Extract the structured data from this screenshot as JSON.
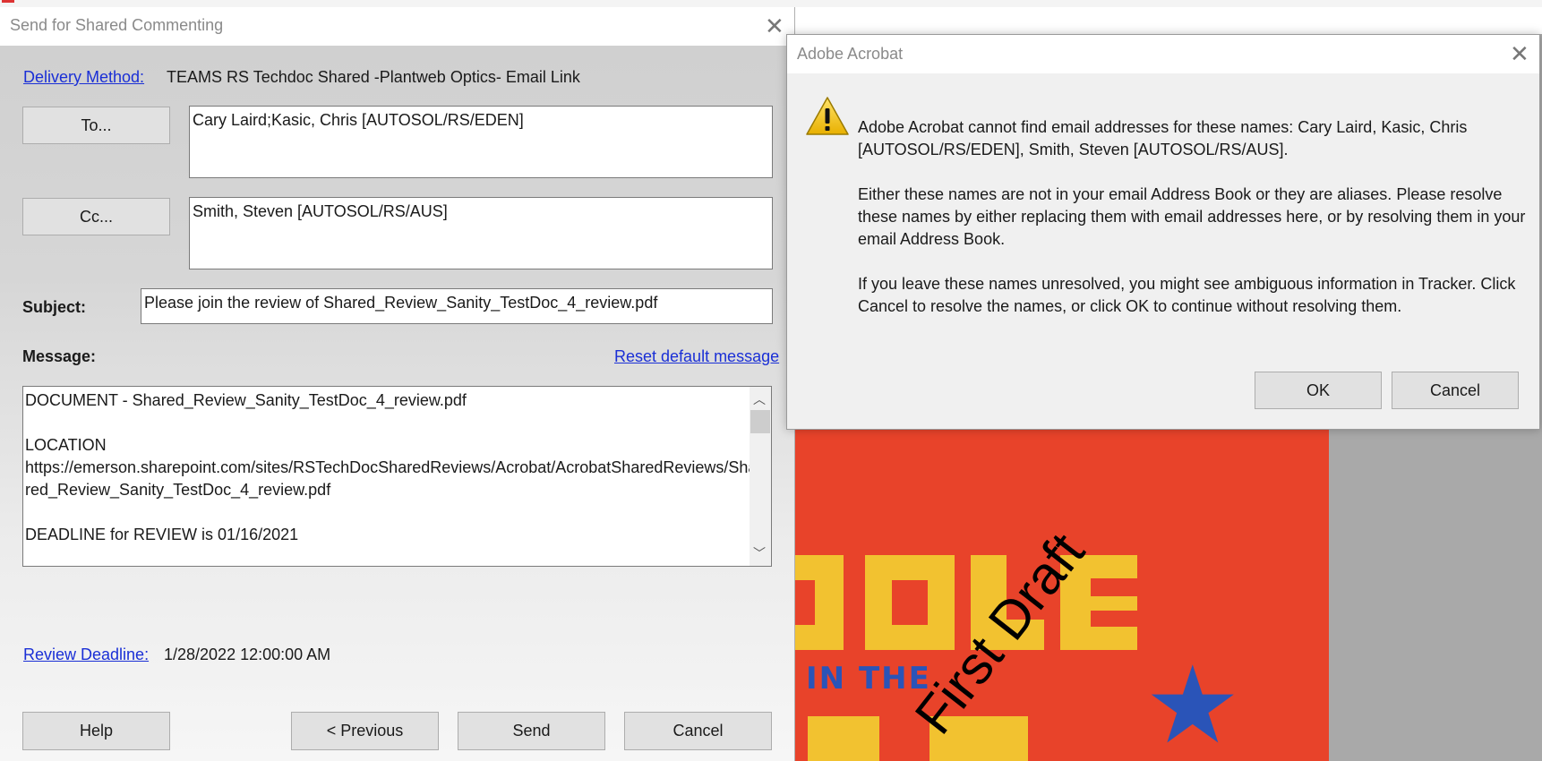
{
  "send_dialog": {
    "title": "Send for Shared Commenting",
    "delivery_method_label": "Delivery Method:",
    "delivery_method_value": "TEAMS RS Techdoc Shared -Plantweb Optics- Email Link",
    "to_button": "To...",
    "to_value": "Cary Laird;Kasic, Chris [AUTOSOL/RS/EDEN]",
    "cc_button": "Cc...",
    "cc_value": "Smith, Steven [AUTOSOL/RS/AUS]",
    "subject_label": "Subject:",
    "subject_value": "Please join the review of Shared_Review_Sanity_TestDoc_4_review.pdf",
    "message_label": "Message:",
    "reset_link": "Reset default message",
    "message_lines": [
      "DOCUMENT - Shared_Review_Sanity_TestDoc_4_review.pdf",
      "",
      "LOCATION",
      "https://emerson.sharepoint.com/sites/RSTechDocSharedReviews/Acrobat/AcrobatSharedReviews/Sha",
      "red_Review_Sanity_TestDoc_4_review.pdf",
      "",
      "DEADLINE for REVIEW is 01/16/2021"
    ],
    "review_deadline_label": "Review Deadline:",
    "review_deadline_value": "1/28/2022 12:00:00 AM",
    "buttons": {
      "help": "Help",
      "previous": "< Previous",
      "send": "Send",
      "cancel": "Cancel"
    }
  },
  "alert_dialog": {
    "title": "Adobe Acrobat",
    "paragraphs": [
      "Adobe Acrobat cannot find email addresses for these names: Cary Laird, Kasic, Chris [AUTOSOL/RS/EDEN], Smith, Steven [AUTOSOL/RS/AUS].",
      "Either these names are not in your email Address Book or they are aliases. Please resolve these names by either replacing them with email addresses here, or by resolving them in your email Address Book.",
      "If you leave these names unresolved, you might see ambiguous information in Tracker. Click Cancel to resolve the names, or click OK to continue without resolving them."
    ],
    "ok_button": "OK",
    "cancel_button": "Cancel",
    "icon": "warning-icon"
  },
  "background_document": {
    "cover_text": "IN THE",
    "watermark": "First Draft"
  },
  "colors": {
    "link": "#1a2fd6",
    "cover_red": "#e8432a",
    "cover_yellow": "#f2c230",
    "cover_blue": "#2a54b8",
    "warning_yellow": "#f5c400"
  }
}
